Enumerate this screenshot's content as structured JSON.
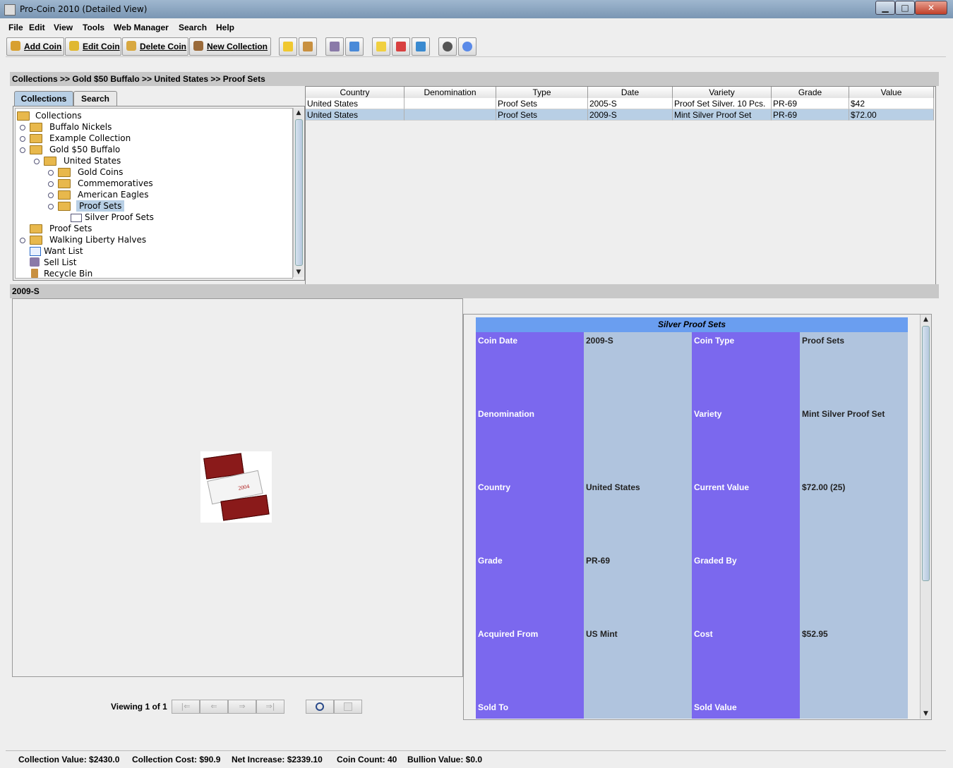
{
  "window": {
    "title": "Pro-Coin 2010 (Detailed View)",
    "min": "▁",
    "max": "□",
    "close": "✕"
  },
  "menu": [
    "File",
    "Edit",
    "View",
    "Tools",
    "Web Manager",
    "Search",
    "Help"
  ],
  "toolbar": {
    "add_coin": "Add Coin",
    "edit_coin": "Edit Coin",
    "delete_coin": "Delete Coin",
    "new_collection": "New Collection"
  },
  "breadcrumb": "Collections >> Gold $50 Buffalo >> United States >> Proof Sets",
  "tabs": {
    "collections": "Collections",
    "search": "Search"
  },
  "tree": [
    "Collections",
    "Buffalo Nickels",
    "Example Collection",
    "Gold $50 Buffalo",
    "United States",
    "Gold Coins",
    "Commemoratives",
    "American Eagles",
    "Proof Sets",
    "Silver Proof Sets",
    "Proof Sets",
    "Walking Liberty Halves",
    "Want List",
    "Sell List",
    "Recycle Bin"
  ],
  "table": {
    "headers": [
      "Country",
      "Denomination",
      "Type",
      "Date",
      "Variety",
      "Grade",
      "Value"
    ],
    "rows": [
      [
        "United States",
        "",
        "Proof Sets",
        "2005-S",
        "Proof Set Silver. 10 Pcs.",
        "PR-69",
        "$42"
      ],
      [
        "United States",
        "",
        "Proof Sets",
        "2009-S",
        "Mint Silver Proof Set",
        "PR-69",
        "$72.00"
      ]
    ]
  },
  "selected_title": "2009-S",
  "image_thumb": {
    "year": "2004"
  },
  "viewer": {
    "label": "Viewing 1 of 1",
    "first": "|⇐",
    "prev": "⇐",
    "next": "⇒",
    "last": "⇒|"
  },
  "details": {
    "title": "Silver Proof Sets",
    "rows": [
      {
        "l1": "Coin Date",
        "v1": "2009-S",
        "l2": "Coin Type",
        "v2": "Proof Sets"
      },
      {
        "l1": "Denomination",
        "v1": "",
        "l2": "Variety",
        "v2": "Mint Silver Proof Set"
      },
      {
        "l1": "Country",
        "v1": "United States",
        "l2": "Current Value",
        "v2": "$72.00 (25)"
      },
      {
        "l1": "Grade",
        "v1": "PR-69",
        "l2": "Graded By",
        "v2": ""
      },
      {
        "l1": "Acquired From",
        "v1": "US Mint",
        "l2": "Cost",
        "v2": "$52.95"
      },
      {
        "l1": "Sold To",
        "v1": "",
        "l2": "Sold Value",
        "v2": ""
      }
    ]
  },
  "status": {
    "collection_value": "Collection Value: $2430.0",
    "collection_cost": "Collection Cost: $90.9",
    "net_increase": "Net Increase: $2339.10",
    "coin_count": "Coin Count: 40",
    "bullion_value": "Bullion Value: $0.0"
  },
  "colors": {
    "label_column": "#7b68ee",
    "value_column": "#b0c4de",
    "header": "#6a9ef0",
    "selection": "#b8cfe5"
  }
}
